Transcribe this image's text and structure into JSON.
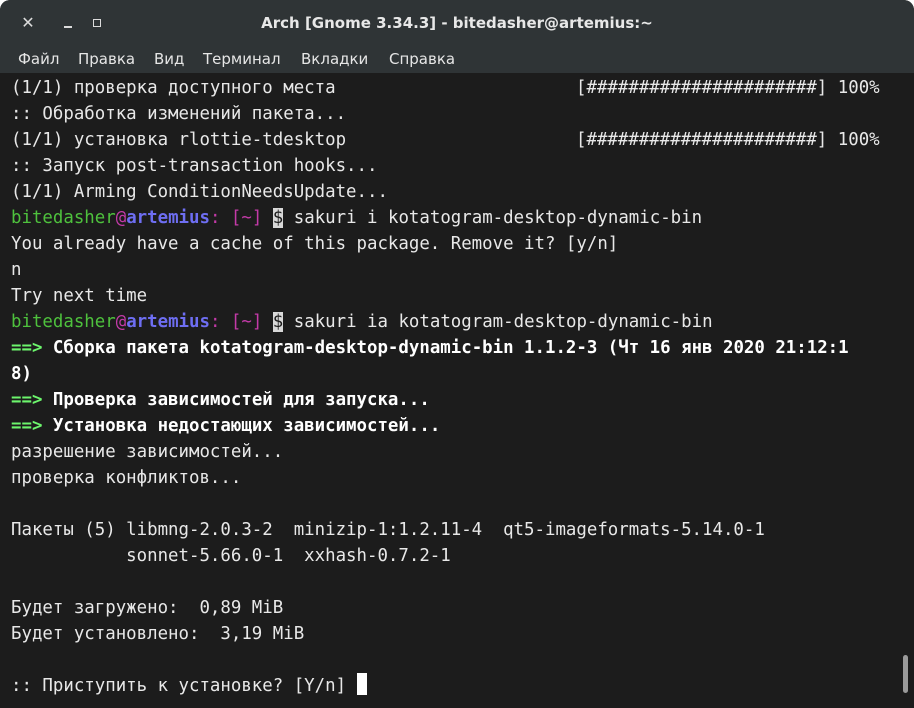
{
  "window": {
    "title": "Arch [Gnome 3.34.3] - bitedasher@artemius:~"
  },
  "menu": [
    "Файл",
    "Правка",
    "Вид",
    "Терминал",
    "Вкладки",
    "Справка"
  ],
  "lines": {
    "l1": "(1/1) проверка доступного места",
    "l1r": "[######################] 100%",
    "l2": ":: Обработка изменений пакета...",
    "l3": "(1/1) установка rlottie-tdesktop",
    "l3r": "[######################] 100%",
    "l4": ":: Запуск post-transaction hooks...",
    "l5": "(1/1) Arming ConditionNeedsUpdate...",
    "prompt_user": "bitedasher",
    "prompt_at": "@",
    "prompt_host": "artemius",
    "prompt_dir": ": [~]",
    "prompt_symbol": "$",
    "cmd1": " sakuri i kotatogram-desktop-dynamic-bin",
    "l7": "You already have a cache of this package. Remove it? [y/n]",
    "l8": "n",
    "l9": "Try next time",
    "cmd2": " sakuri ia kotatogram-desktop-dynamic-bin",
    "arrow": "==>",
    "l11": " Сборка пакета kotatogram-desktop-dynamic-bin 1.1.2-3 (Чт 16 янв 2020 21:12:1",
    "l12": "8)",
    "l13": " Проверка зависимостей для запуска...",
    "l14": " Установка недостающих зависимостей...",
    "l15": "разрешение зависимостей...",
    "l16": "проверка конфликтов...",
    "l18": "Пакеты (5) libmng-2.0.3-2  minizip-1:1.2.11-4  qt5-imageformats-5.14.0-1",
    "l19": "           sonnet-5.66.0-1  xxhash-0.7.2-1",
    "l21": "Будет загружено:  0,89 MiB",
    "l22": "Будет установлено:  3,19 MiB",
    "l24": ":: Приступить к установке? [Y/n] "
  }
}
